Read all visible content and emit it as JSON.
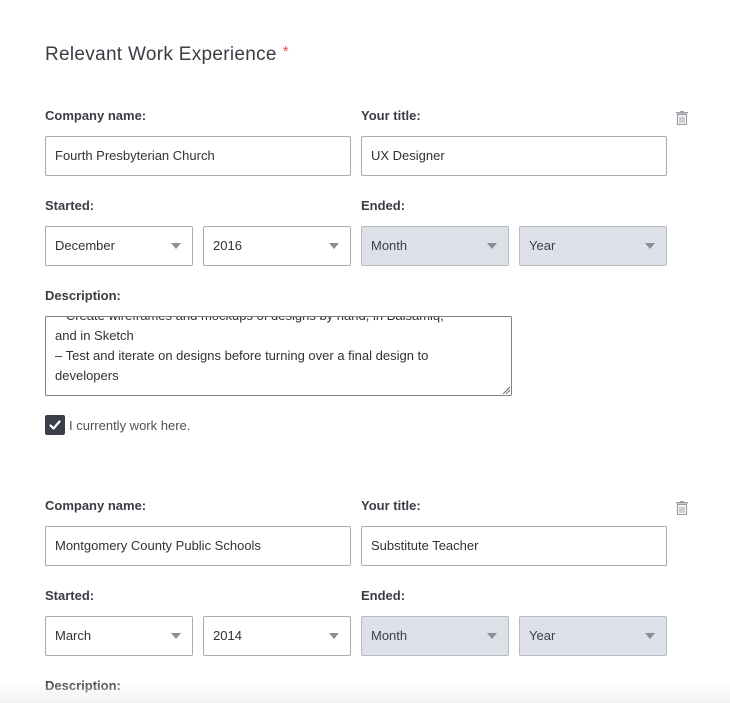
{
  "section": {
    "title": "Relevant Work Experience",
    "required_mark": "*"
  },
  "labels": {
    "company": "Company name:",
    "title": "Your title:",
    "started": "Started:",
    "ended": "Ended:",
    "description": "Description:",
    "current": "I currently work here."
  },
  "entries": [
    {
      "company": "Fourth Presbyterian Church",
      "title": "UX Designer",
      "start_month": "December",
      "start_year": "2016",
      "end_month": "Month",
      "end_year": "Year",
      "description_lines": [
        "– Create wireframes and mockups of designs by hand, in Balsamiq,",
        "and in Sketch",
        "– Test and iterate on designs before turning over a final design to",
        "developers"
      ],
      "currently_works_here": true
    },
    {
      "company": "Montgomery County Public Schools",
      "title": "Substitute Teacher",
      "start_month": "March",
      "start_year": "2014",
      "end_month": "Month",
      "end_year": "Year"
    }
  ],
  "icons": {
    "delete": "trash-icon",
    "dropdown": "chevron-down-icon",
    "check": "checkmark-icon"
  },
  "colors": {
    "required": "#d9534f",
    "disabled_select": "#dde1e7",
    "checkbox": "#3a3f4a"
  }
}
